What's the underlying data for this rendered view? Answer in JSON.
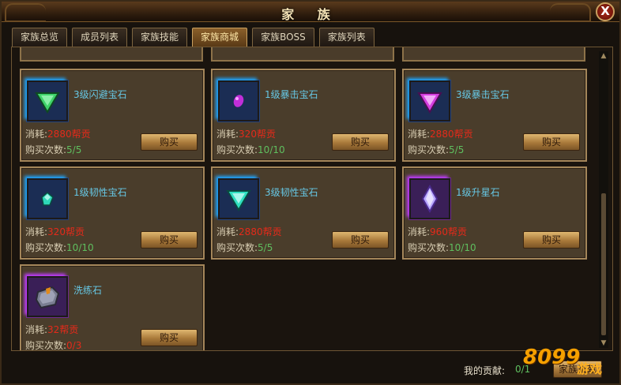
{
  "window": {
    "title": "家 族",
    "close": "X"
  },
  "tabs": [
    {
      "label": "家族总览"
    },
    {
      "label": "成员列表"
    },
    {
      "label": "家族技能"
    },
    {
      "label": "家族商城",
      "active": true
    },
    {
      "label": "家族BOSS"
    },
    {
      "label": "家族列表"
    }
  ],
  "labels": {
    "cost": "消耗:",
    "count": "购买次数:",
    "buy": "购买"
  },
  "items": [
    {
      "name": "3级闪避宝石",
      "cost": "2880帮贡",
      "count": "5/5",
      "icon": "green-triangle-gem-icon",
      "color": "#3fd36a"
    },
    {
      "name": "1级暴击宝石",
      "cost": "320帮贡",
      "count": "10/10",
      "icon": "purple-gem-icon",
      "color": "#c02ed8"
    },
    {
      "name": "3级暴击宝石",
      "cost": "2880帮贡",
      "count": "5/5",
      "icon": "purple-triangle-gem-icon",
      "color": "#d43ee0"
    },
    {
      "name": "1级韧性宝石",
      "cost": "320帮贡",
      "count": "10/10",
      "icon": "teal-gem-icon",
      "color": "#2ed8b8"
    },
    {
      "name": "3级韧性宝石",
      "cost": "2880帮贡",
      "count": "5/5",
      "icon": "teal-triangle-gem-icon",
      "color": "#2fe0c0"
    },
    {
      "name": "1级升星石",
      "cost": "960帮贡",
      "count": "10/10",
      "icon": "star-crystal-icon",
      "color": "#c8b8ff"
    },
    {
      "name": "洗练石",
      "cost": "32帮贡",
      "count": "0/3",
      "count_red": true,
      "icon": "refining-stone-icon",
      "color": "#8a8a9a"
    }
  ],
  "footer": {
    "label": "我的贡献:",
    "value": "0/1",
    "button": "家族贡献"
  },
  "watermark": {
    "text": "8099",
    "sub": "游戏"
  }
}
